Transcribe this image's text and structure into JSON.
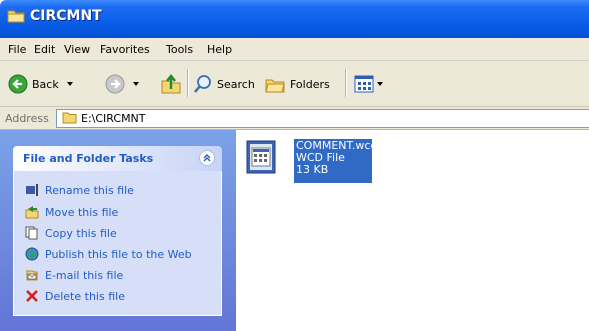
{
  "window": {
    "title": "CIRCMNT"
  },
  "menu": [
    "File",
    "Edit",
    "View",
    "Favorites",
    "Tools",
    "Help"
  ],
  "toolbar": {
    "back_label": "Back",
    "search_label": "Search",
    "folders_label": "Folders"
  },
  "address": {
    "label": "Address",
    "path": "E:\\CIRCMNT"
  },
  "tasks_panel": {
    "title": "File and Folder Tasks",
    "items": [
      {
        "label": "Rename this file",
        "icon": "rename-icon"
      },
      {
        "label": "Move this file",
        "icon": "move-icon"
      },
      {
        "label": "Copy this file",
        "icon": "copy-icon"
      },
      {
        "label": "Publish this file to the Web",
        "icon": "publish-icon"
      },
      {
        "label": "E-mail this file",
        "icon": "email-icon"
      },
      {
        "label": "Delete this file",
        "icon": "delete-icon"
      }
    ]
  },
  "file": {
    "name": "COMMENT.wcd",
    "type": "WCD File",
    "size": "13 KB"
  },
  "colors": {
    "title_bar": "#0a5ee8",
    "selection": "#316ac5",
    "task_link": "#215dc6",
    "pane_bg": "#6f8fdf"
  }
}
